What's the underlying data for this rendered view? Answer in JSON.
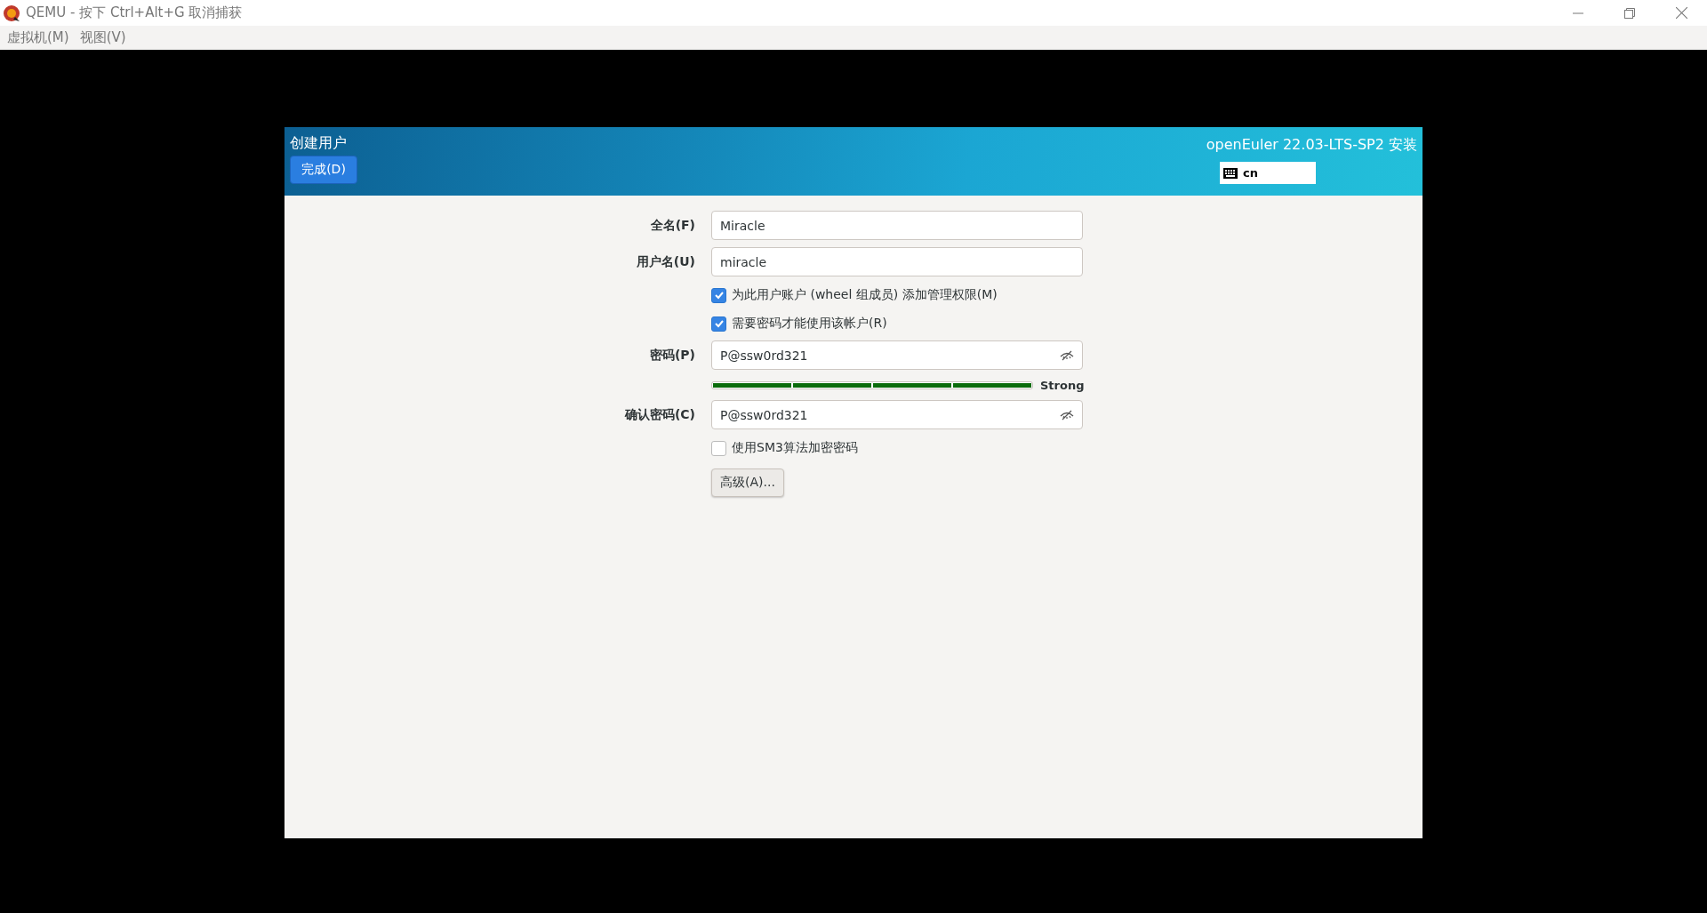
{
  "window": {
    "title": "QEMU - 按下 Ctrl+Alt+G 取消捕获"
  },
  "menu": [
    "虚拟机(M)",
    "视图(V)"
  ],
  "installer": {
    "page_title": "创建用户",
    "done_button": "完成(D)",
    "product": "openEuler 22.03-LTS-SP2 安装",
    "keyboard_layout": "cn"
  },
  "form": {
    "fields": [
      {
        "kind": "text",
        "label": "全名(F)",
        "value": "Miracle"
      },
      {
        "kind": "text",
        "label": "用户名(U)",
        "value": "miracle"
      },
      {
        "kind": "checkbox",
        "label": "为此用户账户 (wheel 组成员) 添加管理权限(M)",
        "checked": true
      },
      {
        "kind": "checkbox",
        "label": "需要密码才能使用该帐户(R)",
        "checked": true
      },
      {
        "kind": "password",
        "label": "密码(P)",
        "value": "P@ssw0rd321"
      },
      {
        "kind": "strength",
        "level": 1,
        "reading": "Strong"
      },
      {
        "kind": "password",
        "label": "确认密码(C)",
        "value": "P@ssw0rd321"
      },
      {
        "kind": "checkbox",
        "label": "使用SM3算法加密密码",
        "checked": false
      },
      {
        "kind": "button",
        "label": "高级(A)..."
      }
    ]
  }
}
